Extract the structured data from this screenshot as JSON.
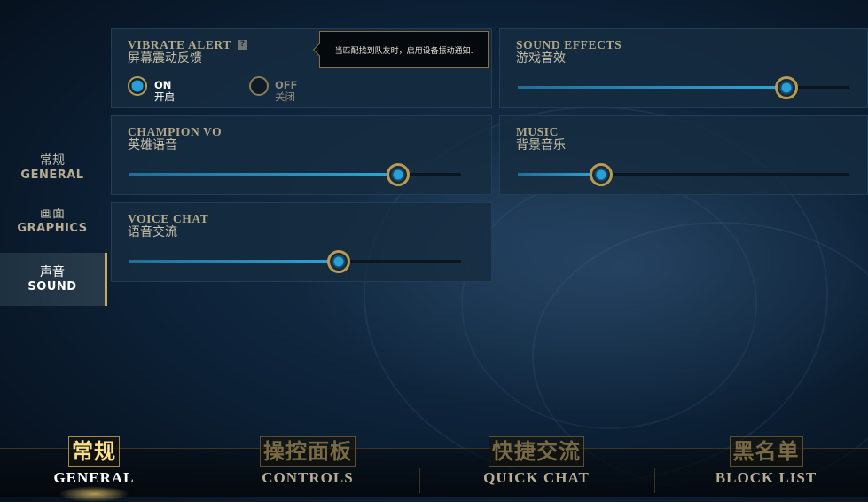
{
  "sidebar": {
    "items": [
      {
        "zh": "常规",
        "en": "GENERAL",
        "active": false
      },
      {
        "zh": "画面",
        "en": "GRAPHICS",
        "active": false
      },
      {
        "zh": "声音",
        "en": "SOUND",
        "active": true
      }
    ]
  },
  "vibrate": {
    "title": "VIBRATE ALERT",
    "subtitle": "屏幕震动反馈",
    "help_icon": "?",
    "on": {
      "en": "ON",
      "zh": "开启",
      "selected": true
    },
    "off": {
      "en": "OFF",
      "zh": "关闭",
      "selected": false
    },
    "tooltip": "当匹配找到队友时，启用设备振动通知."
  },
  "sound_effects": {
    "title": "SOUND EFFECTS",
    "subtitle": "游戏音效",
    "value": 0.81
  },
  "champion_vo": {
    "title": "CHAMPION VO",
    "subtitle": "英雄语音",
    "value": 0.81
  },
  "music": {
    "title": "MUSIC",
    "subtitle": "背景音乐",
    "value": 0.25
  },
  "voice_chat": {
    "title": "VOICE CHAT",
    "subtitle": "语音交流",
    "value": 0.63
  },
  "tabs": [
    {
      "zh": "常规",
      "en": "GENERAL",
      "active": true
    },
    {
      "zh": "操控面板",
      "en": "CONTROLS",
      "active": false
    },
    {
      "zh": "快捷交流",
      "en": "QUICK CHAT",
      "active": false
    },
    {
      "zh": "黑名单",
      "en": "BLOCK LIST",
      "active": false
    }
  ],
  "colors": {
    "accent_gold": "#c9a85a",
    "slider_blue": "#2fa3d8",
    "panel_bg": "#162c40"
  }
}
